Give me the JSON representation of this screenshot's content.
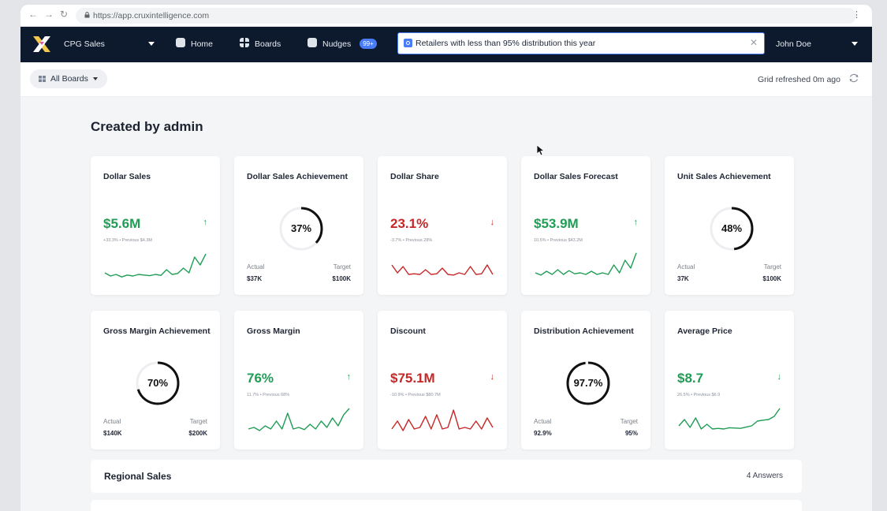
{
  "browser": {
    "url": "https://app.cruxintelligence.com",
    "back_icon": "arrow-left-icon",
    "forward_icon": "arrow-right-icon",
    "reload_icon": "reload-icon"
  },
  "nav": {
    "workspace": "CPG Sales",
    "home": "Home",
    "boards": "Boards",
    "nudges": "Nudges",
    "nudges_badge": "99+",
    "search_value": "Retailers with less than 95% distribution this year",
    "user": "John Doe"
  },
  "subbar": {
    "all_boards": "All Boards",
    "refreshed": "Grid refreshed 0m ago"
  },
  "section": {
    "title": "Created by admin"
  },
  "colors": {
    "positive": "#1f9d55",
    "negative": "#c62828",
    "accent": "#4a7cf7",
    "nav_bg": "#0d1a2e"
  },
  "cards": [
    {
      "title": "Dollar Sales",
      "type": "kpi",
      "value": "$5.6M",
      "trend": "up",
      "sub": "+33.3% • Previous $4.3M",
      "spark": [
        0.35,
        0.25,
        0.3,
        0.22,
        0.28,
        0.25,
        0.3,
        0.28,
        0.26,
        0.3,
        0.27,
        0.45,
        0.3,
        0.33,
        0.5,
        0.35,
        0.85,
        0.6,
        0.95
      ]
    },
    {
      "title": "Dollar Sales Achievement",
      "type": "ring",
      "ring_value": "37%",
      "ring_fraction": 0.37,
      "actual_label": "Actual",
      "target_label": "Target",
      "actual": "$37K",
      "target": "$100K"
    },
    {
      "title": "Dollar Share",
      "type": "kpi",
      "value": "23.1%",
      "trend": "down",
      "sub": "-3.7% • Previous 28%",
      "spark": [
        0.6,
        0.35,
        0.55,
        0.3,
        0.32,
        0.3,
        0.45,
        0.3,
        0.32,
        0.5,
        0.3,
        0.28,
        0.35,
        0.3,
        0.55,
        0.3,
        0.32,
        0.6,
        0.3
      ]
    },
    {
      "title": "Dollar Sales Forecast",
      "type": "kpi",
      "value": "$53.9M",
      "trend": "up",
      "sub": "10.5% • Previous $43.2M",
      "spark": [
        0.35,
        0.28,
        0.4,
        0.3,
        0.45,
        0.3,
        0.42,
        0.32,
        0.35,
        0.3,
        0.4,
        0.3,
        0.35,
        0.3,
        0.6,
        0.35,
        0.75,
        0.5,
        0.98
      ]
    },
    {
      "title": "Unit Sales Achievement",
      "type": "ring",
      "ring_value": "48%",
      "ring_fraction": 0.48,
      "actual_label": "Actual",
      "target_label": "Target",
      "actual": "37K",
      "target": "$100K"
    },
    {
      "title": "Gross Margin Achievement",
      "type": "ring",
      "ring_value": "70%",
      "ring_fraction": 0.7,
      "actual_label": "Actual",
      "target_label": "Target",
      "actual": "$140K",
      "target": "$200K"
    },
    {
      "title": "Gross Margin",
      "type": "kpi",
      "value": "76%",
      "trend": "up",
      "sub": "11.7% • Previous 68%",
      "spark": [
        0.3,
        0.35,
        0.25,
        0.4,
        0.3,
        0.55,
        0.3,
        0.8,
        0.3,
        0.35,
        0.28,
        0.45,
        0.3,
        0.55,
        0.35,
        0.65,
        0.4,
        0.75,
        0.95
      ]
    },
    {
      "title": "Discount",
      "type": "kpi",
      "value": "$75.1M",
      "trend": "down",
      "sub": "-10.9% • Previous $80.7M",
      "spark": [
        0.3,
        0.55,
        0.25,
        0.6,
        0.3,
        0.35,
        0.7,
        0.3,
        0.75,
        0.3,
        0.35,
        0.9,
        0.3,
        0.35,
        0.3,
        0.55,
        0.3,
        0.65,
        0.35
      ]
    },
    {
      "title": "Distribution Achievement",
      "type": "ring",
      "ring_value": "97.7%",
      "ring_fraction": 0.977,
      "actual_label": "Actual",
      "target_label": "Target",
      "actual": "92.9%",
      "target": "95%"
    },
    {
      "title": "Average Price",
      "type": "kpi",
      "value": "$8.7",
      "trend": "down",
      "sub": "26.5% • Previous $6.9",
      "spark": [
        0.4,
        0.6,
        0.35,
        0.65,
        0.3,
        0.45,
        0.3,
        0.32,
        0.3,
        0.34,
        0.33,
        0.32,
        0.36,
        0.4,
        0.55,
        0.58,
        0.6,
        0.7,
        0.95
      ]
    }
  ],
  "regional": {
    "title": "Regional Sales",
    "count": "4 Answers"
  }
}
